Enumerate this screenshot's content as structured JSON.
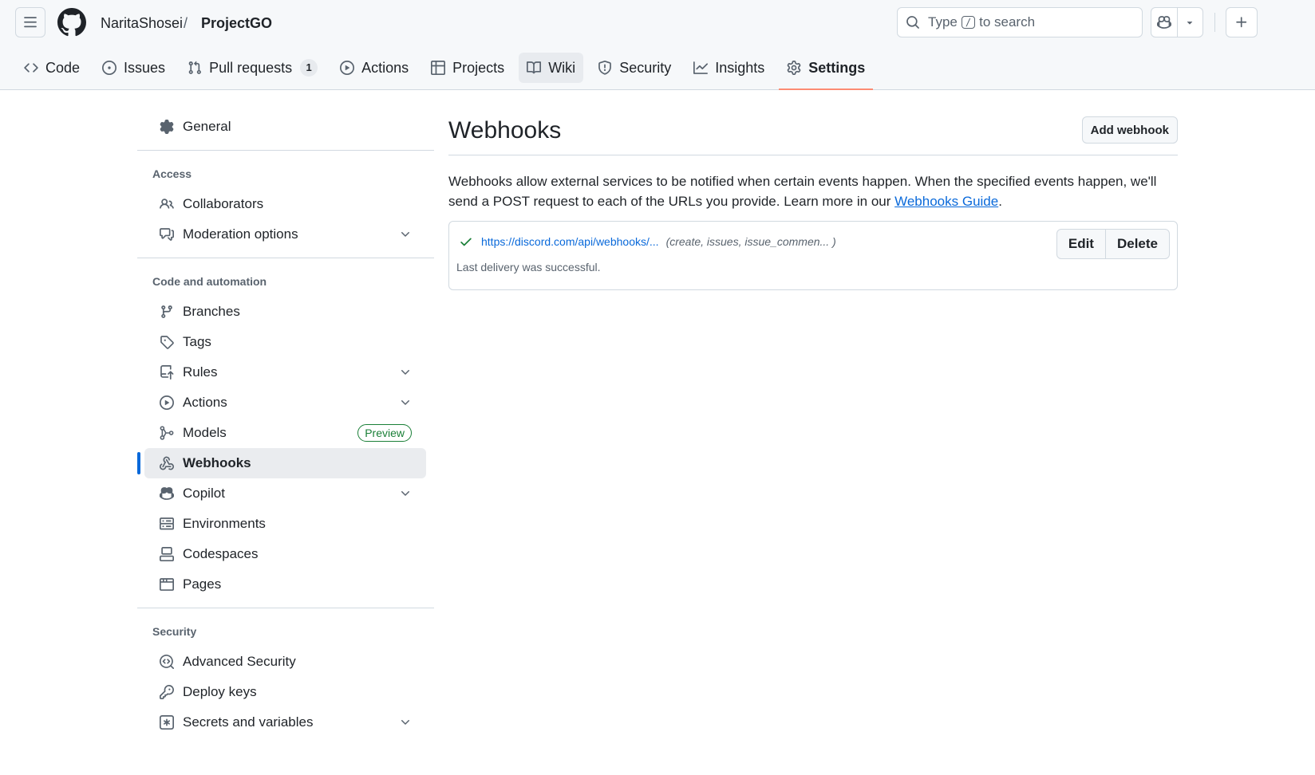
{
  "header": {
    "owner": "NaritaShosei",
    "separator": "/",
    "repo": "ProjectGO",
    "search": {
      "prefix": "Type",
      "key": "/",
      "suffix": "to search"
    }
  },
  "tabs": [
    {
      "label": "Code",
      "icon": "code-icon"
    },
    {
      "label": "Issues",
      "icon": "issue-icon"
    },
    {
      "label": "Pull requests",
      "icon": "pull-request-icon",
      "count": "1"
    },
    {
      "label": "Actions",
      "icon": "play-icon"
    },
    {
      "label": "Projects",
      "icon": "table-icon"
    },
    {
      "label": "Wiki",
      "icon": "book-icon"
    },
    {
      "label": "Security",
      "icon": "shield-icon"
    },
    {
      "label": "Insights",
      "icon": "graph-icon"
    },
    {
      "label": "Settings",
      "icon": "gear-icon"
    }
  ],
  "sidebar": {
    "general": "General",
    "access_heading": "Access",
    "access": [
      "Collaborators",
      "Moderation options"
    ],
    "code_heading": "Code and automation",
    "code": [
      "Branches",
      "Tags",
      "Rules",
      "Actions",
      "Models",
      "Webhooks",
      "Copilot",
      "Environments",
      "Codespaces",
      "Pages"
    ],
    "preview_badge": "Preview",
    "security_heading": "Security",
    "security": [
      "Advanced Security",
      "Deploy keys",
      "Secrets and variables"
    ]
  },
  "main": {
    "title": "Webhooks",
    "add_button": "Add webhook",
    "intro_text": "Webhooks allow external services to be notified when certain events happen. When the specified events happen, we'll send a POST request to each of the URLs you provide. Learn more in our ",
    "intro_link": "Webhooks Guide",
    "intro_end": ".",
    "hook": {
      "url": "https://discord.com/api/webhooks/...",
      "events": "(create, issues, issue_commen... )",
      "status": "Last delivery was successful.",
      "edit": "Edit",
      "delete": "Delete"
    }
  },
  "colors": {
    "accent": "#0969da",
    "active_tab_underline": "#fd8c73",
    "success": "#1a7f37"
  }
}
